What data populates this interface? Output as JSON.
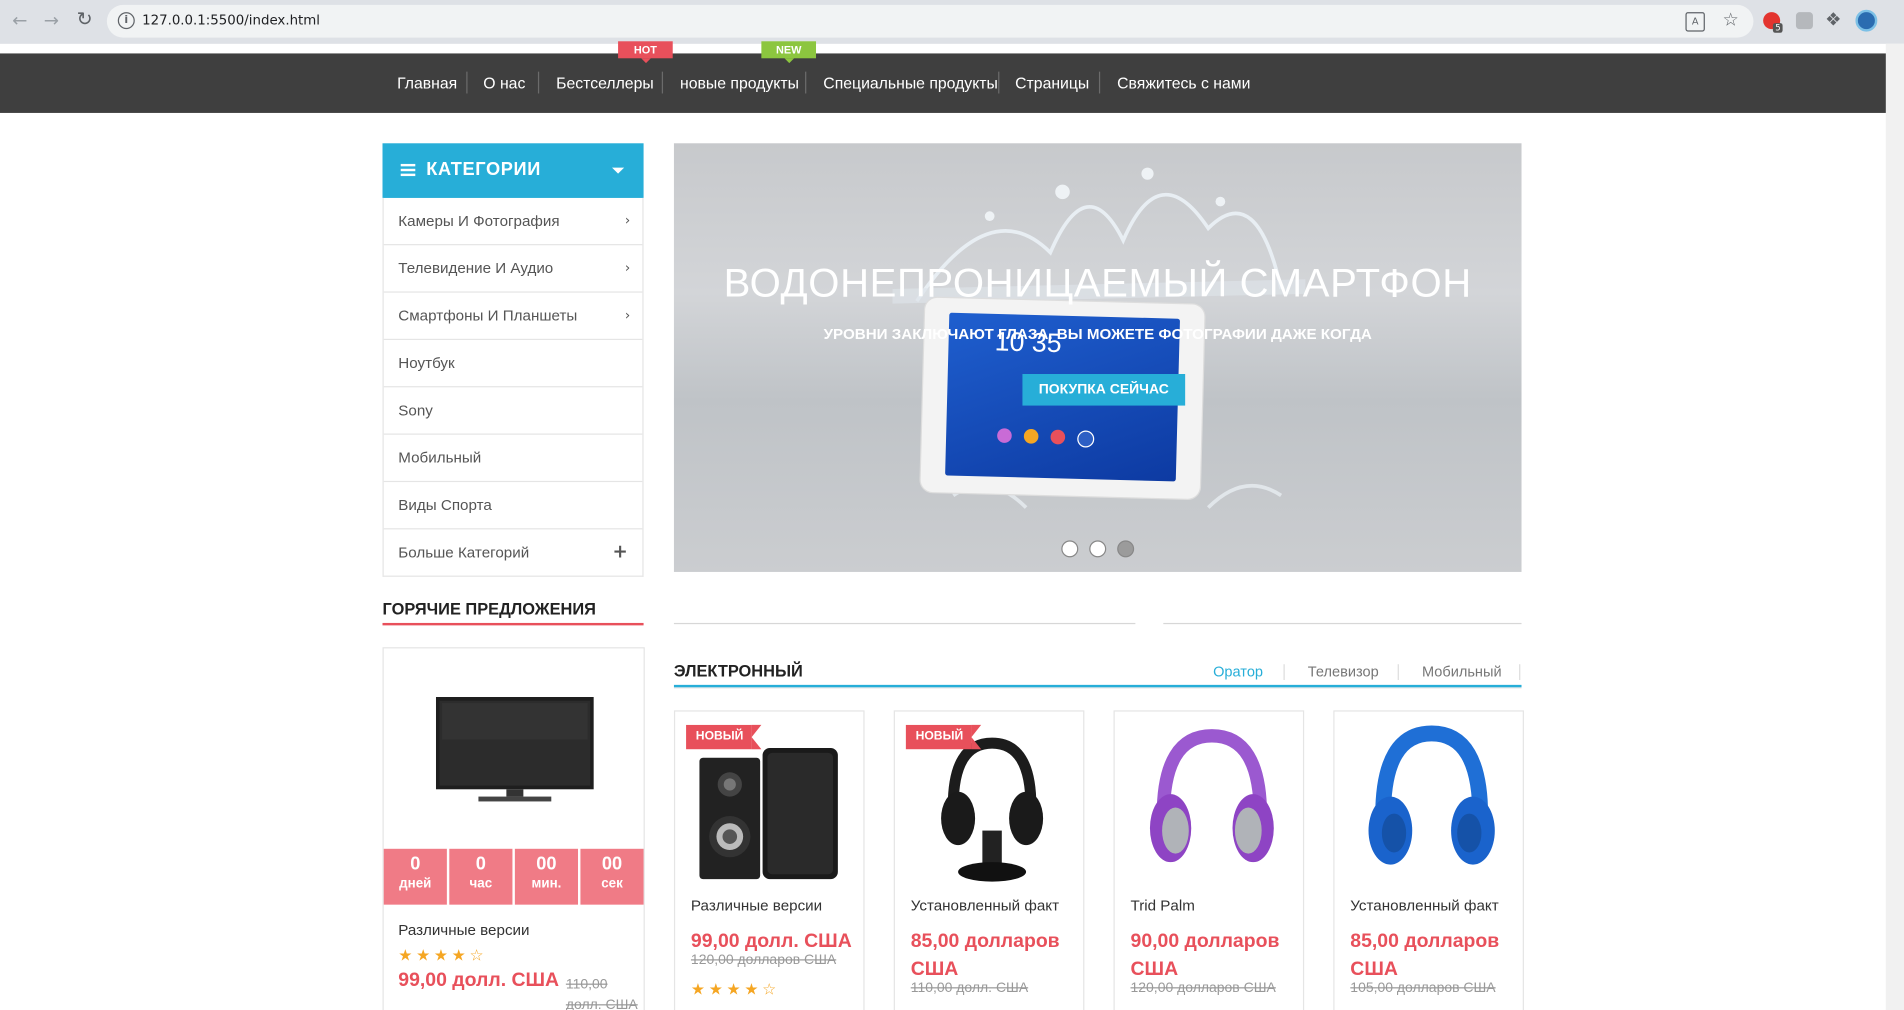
{
  "browser": {
    "url": "127.0.0.1:5500/index.html",
    "back_icon": "arrow-left-icon",
    "forward_icon": "arrow-right-icon",
    "reload_icon": "reload-icon",
    "ext_badge": "5"
  },
  "nav": {
    "items": [
      "Главная",
      "О нас",
      "Бестселлеры",
      "новые продукты",
      "Специальные продукты",
      "Страницы",
      "Свяжитесь с нами"
    ],
    "hot_tag": "HOT",
    "new_tag": "NEW"
  },
  "categories": {
    "title": "КАТЕГОРИИ",
    "items": [
      {
        "label": "Камеры И Фотография",
        "icon": "chevron-right-icon"
      },
      {
        "label": "Телевидение И Аудио",
        "icon": "chevron-right-icon"
      },
      {
        "label": "Смартфоны И Планшеты",
        "icon": "chevron-right-icon"
      },
      {
        "label": "Ноутбук"
      },
      {
        "label": "Sony"
      },
      {
        "label": "Мобильный"
      },
      {
        "label": "Виды Спорта"
      },
      {
        "label": "Больше Категорий",
        "icon": "plus-icon"
      }
    ]
  },
  "hero": {
    "title": "ВОДОНЕПРОНИЦАЕМЫЙ СМАРТФОН",
    "subtitle": "УРОВНИ ЗАКЛЮЧАЮТ ГЛАЗА. ВЫ МОЖЕТЕ ФОТОГРАФИИ ДАЖЕ КОГДА",
    "button": "ПОКУПКА СЕЙЧАС",
    "clock": "10 35",
    "active_slide": 3,
    "slides": 3
  },
  "hot_deals": {
    "title": "ГОРЯЧИЕ ПРЕДЛОЖЕНИЯ",
    "countdown": [
      {
        "value": "0",
        "unit": "дней"
      },
      {
        "value": "0",
        "unit": "час"
      },
      {
        "value": "00",
        "unit": "мин."
      },
      {
        "value": "00",
        "unit": "сек"
      }
    ],
    "product": {
      "name": "Различные версии",
      "rating": 4,
      "price": "99,00 долл. США",
      "old_price": "110,00 долл. США"
    }
  },
  "electronic": {
    "title": "ЭЛЕКТРОННЫЙ",
    "tabs": [
      "Оратор",
      "Телевизор",
      "Мобильный"
    ],
    "active_tab": 0,
    "badge": "НОВЫЙ",
    "products": [
      {
        "name": "Различные версии",
        "price": "99,00 долл. США",
        "old_price": "120,00 долларов США",
        "rating": 4,
        "is_new": true
      },
      {
        "name": "Установленный факт",
        "price": "85,00 долларов США",
        "old_price": "110,00 долл. США",
        "is_new": true
      },
      {
        "name": "Trid Palm",
        "price": "90,00 долларов США",
        "old_price": "120,00 долларов США"
      },
      {
        "name": "Установленный факт",
        "price": "85,00 долларов США",
        "old_price": "105,00 долларов США"
      }
    ]
  },
  "colors": {
    "accent": "#27aed8",
    "sale": "#e8505b",
    "nav_bg": "#3f3f3f",
    "hot_tag": "#e8505b",
    "new_tag": "#8cc63f"
  }
}
